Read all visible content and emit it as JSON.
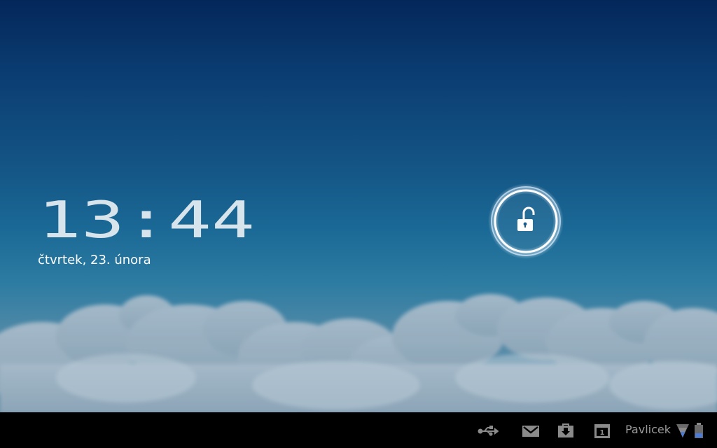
{
  "lockscreen": {
    "time": "13:44",
    "date": "čtvrtek, 23. února"
  },
  "unlock": {
    "icon": "lock-open-icon"
  },
  "statusbar": {
    "carrier": "Pavlicek",
    "icons": [
      "usb-icon",
      "gmail-icon",
      "download-icon",
      "calendar-icon",
      "signal-icon",
      "battery-icon"
    ],
    "calendar_day": "1"
  },
  "colors": {
    "sky_top": "#04275a",
    "sky_bottom": "#6a93ab",
    "clock": "#d8e4ec",
    "unlock_glow": "#e8f4ff",
    "statusbar_bg": "#000000",
    "statusbar_icon": "#8a8a8a",
    "battery_fill": "#4a7bd8"
  }
}
